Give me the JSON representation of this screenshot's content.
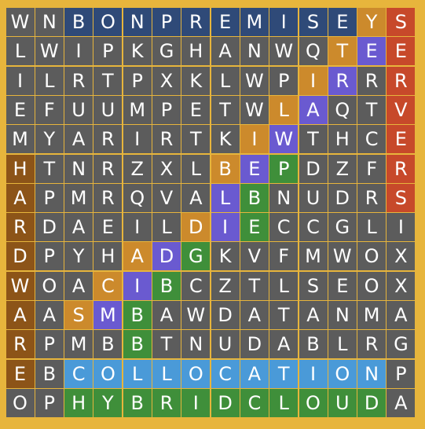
{
  "colors": {
    "frame": "#e7b53c",
    "default": "#5c5c5c",
    "navy": "#2f4a78",
    "brown": "#8c5418",
    "purple": "#6a5ad0",
    "orange": "#cc8a2c",
    "red": "#c7492a",
    "green": "#3f8f3a",
    "lightblue": "#4a9ad8"
  },
  "rows": [
    "WNBONPREMISEYS",
    "LWIPKGHANWQTEE",
    "ILRTPXKLWPIRRR",
    "EFUUMPETWLAQTV",
    "MYARIRTKIWTHCE",
    "HTNRZXLBEPDZFR",
    "APMRQVALBNUDRS",
    "RDAEILDIECCGLI",
    "DPYHADGKVFMWOX",
    "WOACIBCZTLSEOX",
    "AASMBAWDATANMA",
    "RPMBBTNUDABLRG",
    "EBCOLLOCATIONP",
    "OPHYBRIDCLOUDA"
  ],
  "colorMap": [
    "DDNNNNNNNNNNOR",
    "DDDDDDDDDDDOPR",
    "DDDDDDDDDDOPDR",
    "DDDDDDDDDOPDDR",
    "DDDDDDDDOPDDDR",
    "BDDDDDDOPGDDDR",
    "BDDDDDDPGDDDDR",
    "BDDDDDOPGDDDDD",
    "BDDDOPGDDDDDDD",
    "BDDOPGDDDDDDDD",
    "BDOPGDDDDDDDDD",
    "BDDDGDDDDDDDDD",
    "BDLLLLLLLLLLLD",
    "DDGGGGGGGGGGGD"
  ]
}
